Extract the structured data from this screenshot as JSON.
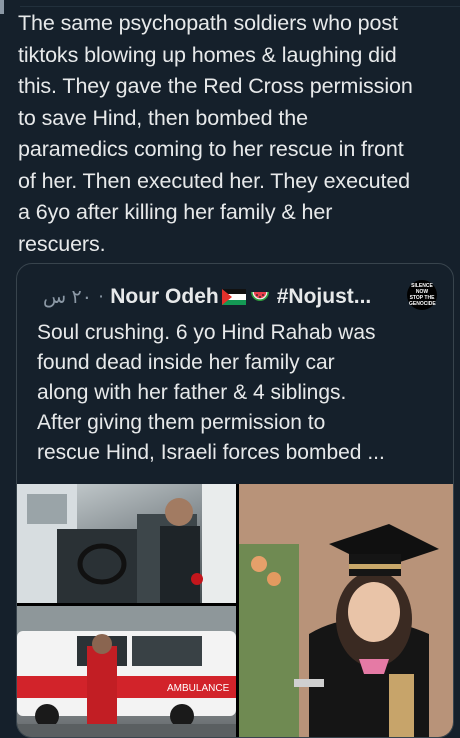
{
  "post": {
    "text": "The same psychopath soldiers who post\ntiktoks blowing up homes & laughing did\nthis. They gave the Red Cross permission\nto save Hind, then bombed the\nparamedics coming to her rescue in front\nof her. Then executed her. They executed\na 6yo after killing her family & her\nrescuers."
  },
  "quote": {
    "timestamp": "٢٠ س",
    "separator": "·",
    "author_name": "Nour Odeh",
    "author_suffix": "#Nojust...",
    "avatar_text": "SILENCE NOW STOP THE GENOCIDE",
    "text": "Soul crushing. 6 yo Hind Rahab was\nfound dead inside her family car\nalong with her father & 4 siblings.\nAfter giving them permission to\nrescue Hind, Israeli forces bombed ...",
    "icons": [
      "palestine-flag-icon",
      "watermelon-icon"
    ]
  },
  "media": {
    "photos": [
      "paramedic-driver-photo",
      "ambulance-photo",
      "child-graduation-photo"
    ],
    "ambulance_label": "AMBULANCE"
  },
  "colors": {
    "background": "#15202b",
    "text": "#e7e9ea",
    "muted": "#8b98a5",
    "border": "#38444d"
  }
}
